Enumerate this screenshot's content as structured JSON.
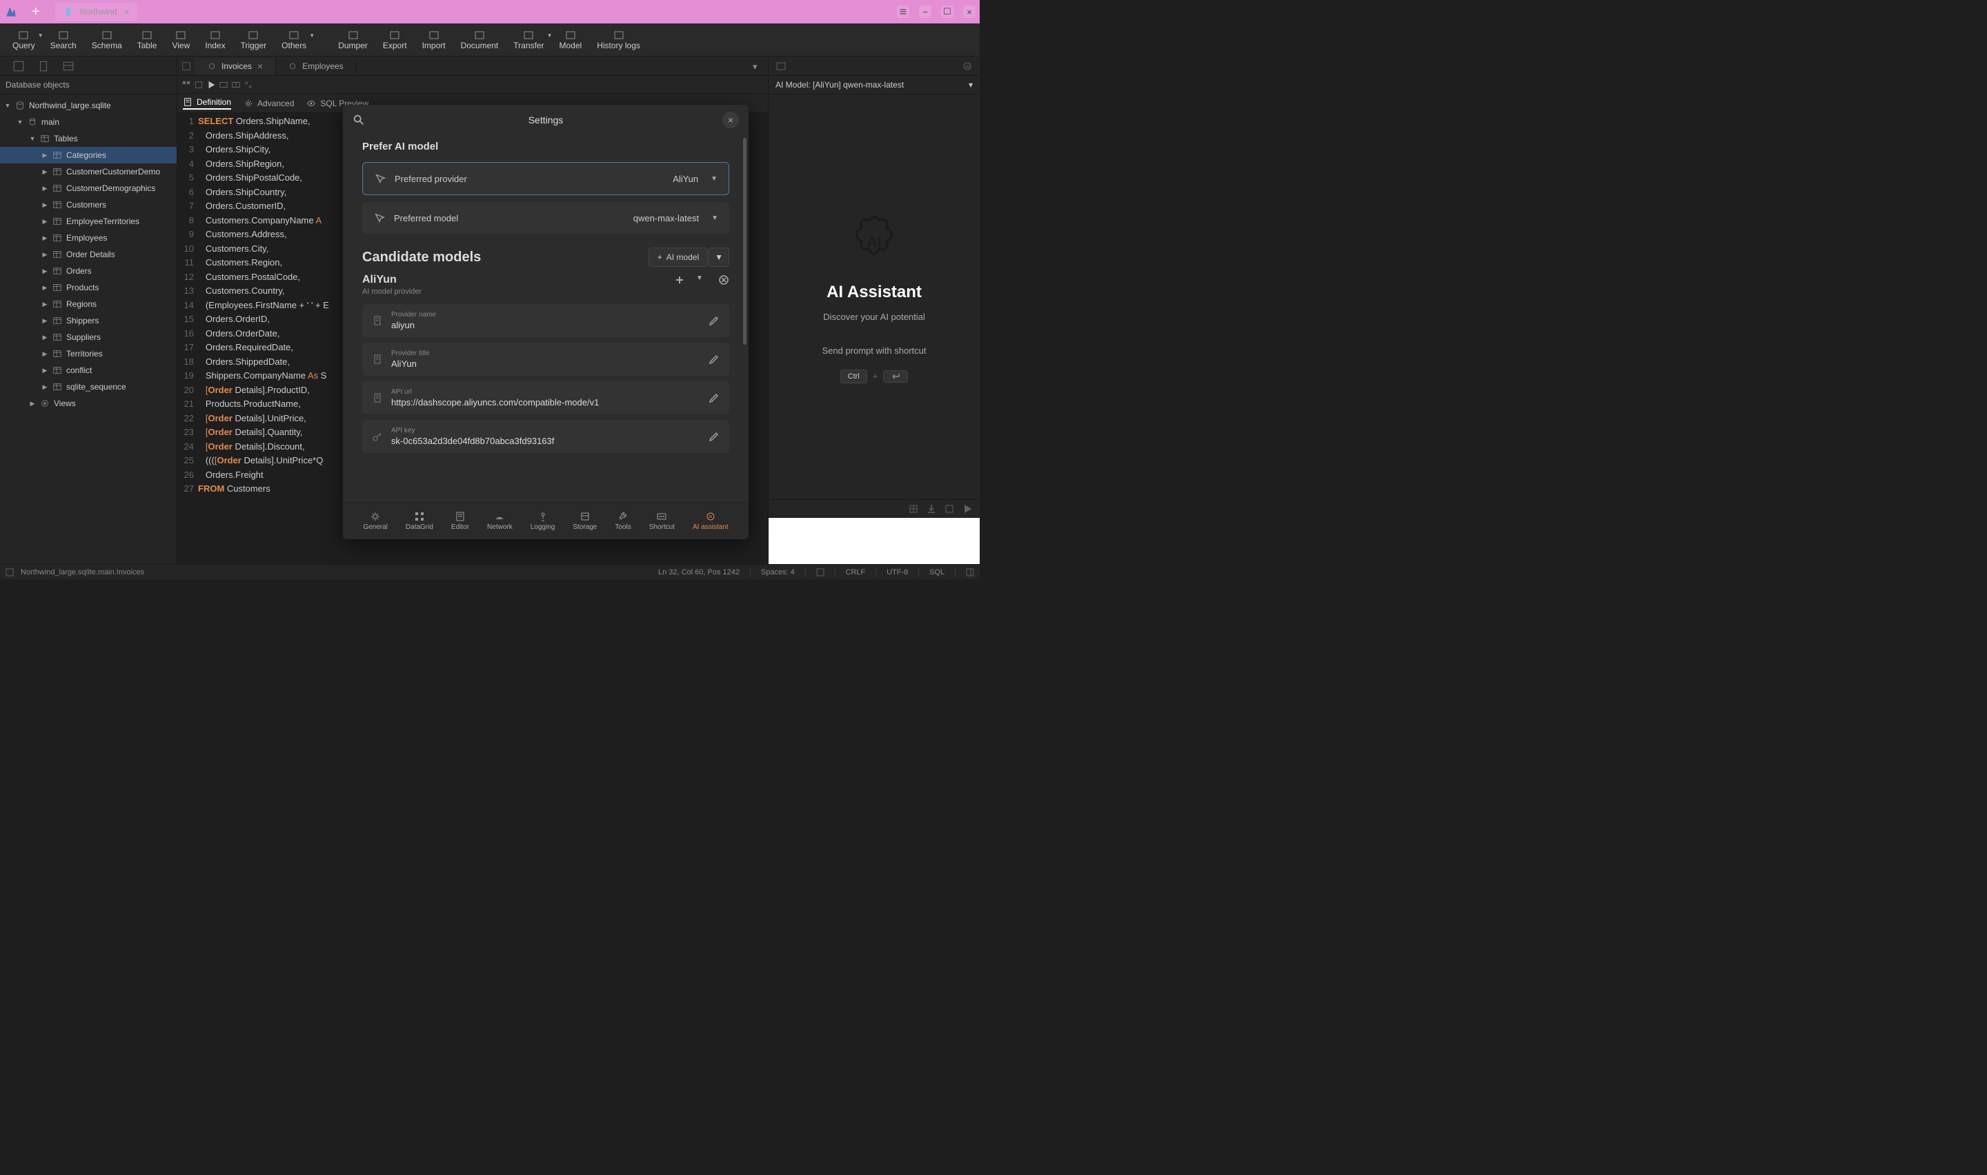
{
  "titlebar": {
    "tab_label": "Northwind"
  },
  "toolbar": [
    {
      "label": "Query",
      "dropdown": true
    },
    {
      "label": "Search"
    },
    {
      "label": "Schema"
    },
    {
      "label": "Table"
    },
    {
      "label": "View"
    },
    {
      "label": "Index"
    },
    {
      "label": "Trigger"
    },
    {
      "label": "Others",
      "dropdown": true
    },
    {
      "label": "Dumper"
    },
    {
      "label": "Export"
    },
    {
      "label": "Import"
    },
    {
      "label": "Document"
    },
    {
      "label": "Transfer",
      "dropdown": true
    },
    {
      "label": "Model"
    },
    {
      "label": "History logs"
    }
  ],
  "sidebar": {
    "header": "Database objects",
    "db": "Northwind_large.sqlite",
    "schema": "main",
    "tables_label": "Tables",
    "tables": [
      "Categories",
      "CustomerCustomerDemo",
      "CustomerDemographics",
      "Customers",
      "EmployeeTerritories",
      "Employees",
      "Order Details",
      "Orders",
      "Products",
      "Regions",
      "Shippers",
      "Suppliers",
      "Territories",
      "conflict",
      "sqlite_sequence"
    ],
    "views_label": "Views"
  },
  "tabs": [
    {
      "label": "Invoices",
      "active": true,
      "closable": true
    },
    {
      "label": "Employees",
      "active": false,
      "closable": false
    }
  ],
  "viewtabs": {
    "definition": "Definition",
    "advanced": "Advanced",
    "sqlpreview": "SQL Preview"
  },
  "code_lines": [
    "SELECT Orders.ShipName,",
    "   Orders.ShipAddress,",
    "   Orders.ShipCity,",
    "   Orders.ShipRegion,",
    "   Orders.ShipPostalCode,",
    "   Orders.ShipCountry,",
    "   Orders.CustomerID,",
    "   Customers.CompanyName A",
    "   Customers.Address,",
    "   Customers.City,",
    "   Customers.Region,",
    "   Customers.PostalCode,",
    "   Customers.Country,",
    "   (Employees.FirstName + ' ' + E",
    "   Orders.OrderID,",
    "   Orders.OrderDate,",
    "   Orders.RequiredDate,",
    "   Orders.ShippedDate,",
    "   Shippers.CompanyName As S",
    "   [Order Details].ProductID,",
    "   Products.ProductName,",
    "   [Order Details].UnitPrice,",
    "   [Order Details].Quantity,",
    "   [Order Details].Discount,",
    "   ((([Order Details].UnitPrice*Q",
    "   Orders.Freight",
    "FROM Customers"
  ],
  "ai": {
    "model_label": "AI Model: [AliYun] qwen-max-latest",
    "title": "AI Assistant",
    "subtitle": "Discover your AI potential",
    "shortcut_label": "Send prompt with shortcut",
    "key": "Ctrl"
  },
  "status": {
    "path": "Northwind_large.sqlite.main.Invoices",
    "pos": "Ln 32, Col 60, Pos 1242",
    "spaces": "Spaces: 4",
    "crlf": "CRLF",
    "enc": "UTF-8",
    "lang": "SQL"
  },
  "settings": {
    "title": "Settings",
    "section_prefer": "Prefer AI model",
    "preferred_provider_label": "Preferred provider",
    "preferred_provider_value": "AliYun",
    "preferred_model_label": "Preferred model",
    "preferred_model_value": "qwen-max-latest",
    "candidate_title": "Candidate models",
    "add_model_label": "AI model",
    "provider_name": "AliYun",
    "provider_sub": "AI model provider",
    "props": [
      {
        "label": "Provider name",
        "value": "aliyun",
        "icon": "clipboard"
      },
      {
        "label": "Provider title",
        "value": "AliYun",
        "icon": "clipboard"
      },
      {
        "label": "API url",
        "value": "https://dashscope.aliyuncs.com/compatible-mode/v1",
        "icon": "clipboard"
      },
      {
        "label": "API key",
        "value": "sk-0c653a2d3de04fd8b70abca3fd93163f",
        "icon": "key"
      }
    ],
    "footer": [
      "General",
      "DataGrid",
      "Editor",
      "Network",
      "Logging",
      "Storage",
      "Tools",
      "Shortcut",
      "AI assistant"
    ]
  }
}
